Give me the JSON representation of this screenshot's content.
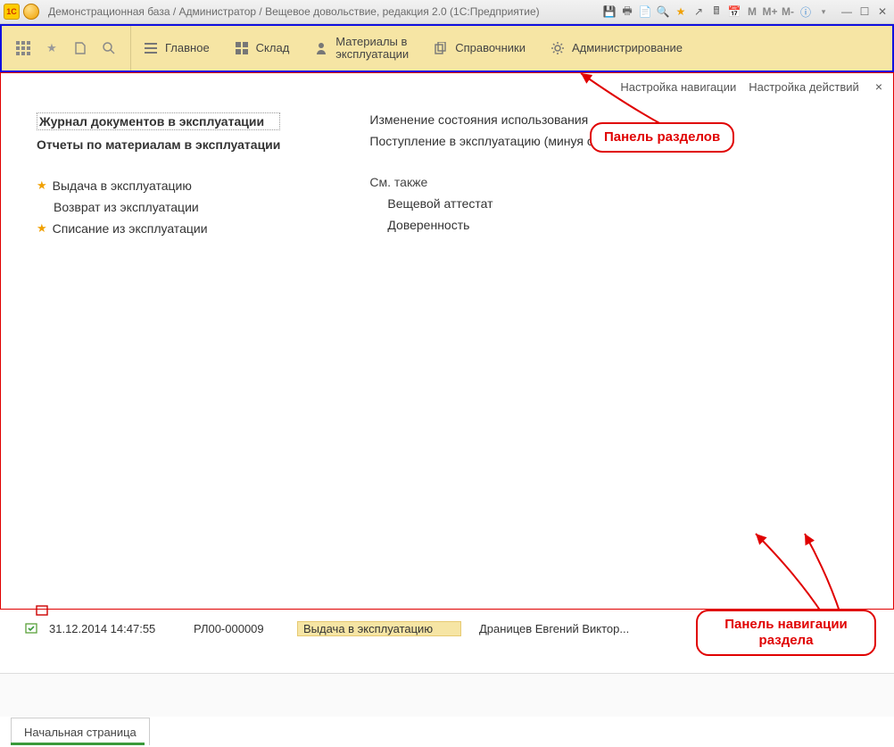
{
  "titlebar": {
    "title": "Демонстрационная база / Администратор / Вещевое довольствие, редакция 2.0  (1С:Предприятие)",
    "buttons": {
      "m": "M",
      "mplus": "M+",
      "mminus": "M-",
      "info": "i",
      "min": "—",
      "max": "☐",
      "close": "✕"
    }
  },
  "sections": {
    "tab1": "Главное",
    "tab2": "Склад",
    "tab3a": "Материалы в",
    "tab3b": "эксплуатации",
    "tab4": "Справочники",
    "tab5": "Администрирование"
  },
  "subtoolbar": {
    "nav_settings": "Настройка навигации",
    "act_settings": "Настройка действий"
  },
  "nav": {
    "col1": {
      "i1": "Журнал документов в эксплуатации",
      "i2": "Отчеты по материалам в эксплуатации",
      "i3": "Выдача в эксплуатацию",
      "i4": "Возврат из эксплуатации",
      "i5": "Списание из эксплуатации"
    },
    "col2": {
      "i1": "Изменение состояния использования",
      "i2": "Поступление в эксплуатацию (минуя склад)",
      "group": "См. также",
      "i3": "Вещевой аттестат",
      "i4": "Доверенность"
    }
  },
  "callouts": {
    "sections": "Панель разделов",
    "navpanel_l1": "Панель навигации",
    "navpanel_l2": "раздела"
  },
  "grid": {
    "row": {
      "date": "31.12.2014 14:47:55",
      "num": "РЛ00-000009",
      "op": "Выдача в эксплуатацию",
      "person": "Драницев Евгений Виктор..."
    }
  },
  "page_tab": "Начальная страница"
}
